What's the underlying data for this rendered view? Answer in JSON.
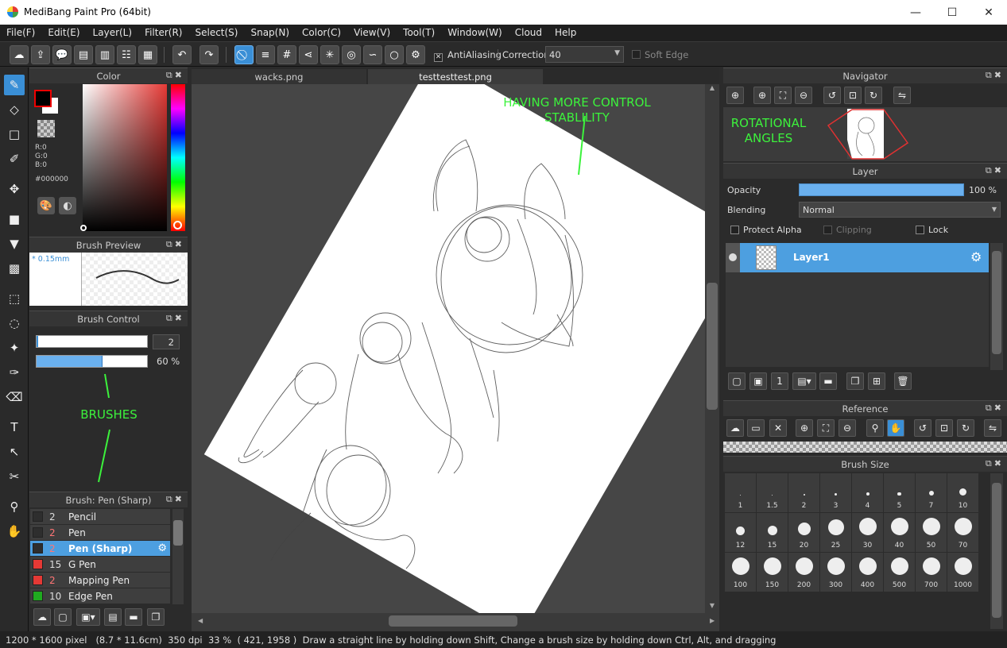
{
  "app": {
    "title": "MediBang Paint Pro (64bit)"
  },
  "window": {
    "minimize": "—",
    "maximize": "☐",
    "close": "✕"
  },
  "menu": [
    "File(F)",
    "Edit(E)",
    "Layer(L)",
    "Filter(R)",
    "Select(S)",
    "Snap(N)",
    "Color(C)",
    "View(V)",
    "Tool(T)",
    "Window(W)",
    "Cloud",
    "Help"
  ],
  "toolbar": {
    "antialias_label": "AntiAliasing",
    "correction_label": "Correction",
    "correction_value": "40",
    "soft_edge_label": "Soft Edge"
  },
  "color_panel": {
    "title": "Color",
    "r": "R:0",
    "g": "G:0",
    "b": "B:0",
    "hex": "#000000",
    "current_color": "#000000"
  },
  "brush_preview": {
    "title": "Brush Preview",
    "size": "* 0.15mm"
  },
  "brush_control": {
    "title": "Brush Control",
    "size_value": "2",
    "opacity_value": "60 %",
    "opacity_fraction": 0.6
  },
  "brush_list": {
    "title": "Brush: Pen (Sharp)",
    "items": [
      {
        "size": "2",
        "name": "Pencil",
        "color": "#2e2e2e"
      },
      {
        "size": "2",
        "name": "Pen",
        "color": "#2e2e2e"
      },
      {
        "size": "2",
        "name": "Pen (Sharp)",
        "color": "#2e2e2e",
        "selected": true
      },
      {
        "size": "15",
        "name": "G Pen",
        "color": "#e53935"
      },
      {
        "size": "2",
        "name": "Mapping Pen",
        "color": "#e53935"
      },
      {
        "size": "10",
        "name": "Edge Pen",
        "color": "#1faa1f"
      }
    ]
  },
  "tabs": [
    {
      "label": "wacks.png"
    },
    {
      "label": "testtesttest.png"
    }
  ],
  "annotations": {
    "control_line1": "HAVING MORE CONTROL",
    "control_line2": "STABLILITY",
    "rotation_line1": "ROTATIONAL",
    "rotation_line2": "ANGLES",
    "brushes": "BRUSHES"
  },
  "navigator": {
    "title": "Navigator"
  },
  "layer_panel": {
    "title": "Layer",
    "opacity_label": "Opacity",
    "opacity_value": "100 %",
    "blending_label": "Blending",
    "blending_value": "Normal",
    "protect_alpha": "Protect Alpha",
    "clipping": "Clipping",
    "lock": "Lock",
    "layers": [
      {
        "name": "Layer1"
      }
    ]
  },
  "reference": {
    "title": "Reference"
  },
  "brush_size": {
    "title": "Brush Size",
    "sizes": [
      "1",
      "1.5",
      "2",
      "3",
      "4",
      "5",
      "7",
      "10",
      "12",
      "15",
      "20",
      "25",
      "30",
      "40",
      "50",
      "70",
      "100",
      "150",
      "200",
      "300",
      "400",
      "500",
      "700",
      "1000"
    ]
  },
  "status": {
    "dimensions": "1200 * 1600 pixel",
    "physical": "(8.7 * 11.6cm)",
    "dpi": "350 dpi",
    "zoom": "33 %",
    "coords": "( 421, 1958 )",
    "hint": "Draw a straight line by holding down Shift, Change a brush size by holding down Ctrl, Alt, and dragging"
  }
}
